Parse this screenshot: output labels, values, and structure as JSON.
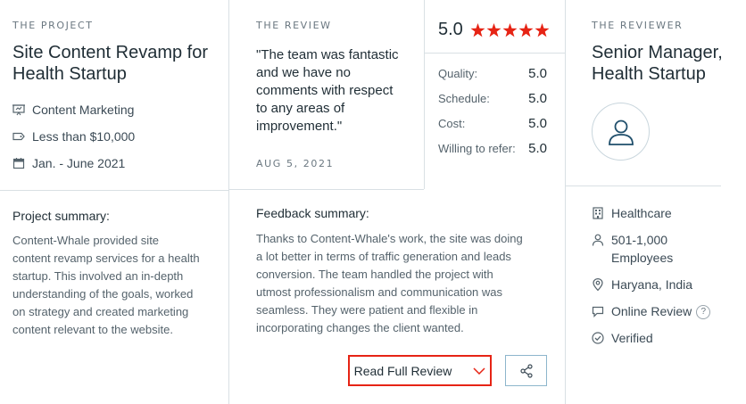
{
  "project": {
    "eyebrow": "THE PROJECT",
    "title_line1": "Site Content Revamp for",
    "title_line2": "Health Startup",
    "service": "Content Marketing",
    "budget": "Less than $10,000",
    "dates": "Jan. - June 2021",
    "summary_label": "Project summary:",
    "summary_lines": [
      "Content-Whale provided site",
      "content revamp services for a health",
      "startup. This involved an in-depth",
      "understanding of the goals, worked",
      "on strategy and created marketing",
      "content relevant to the website."
    ]
  },
  "review": {
    "eyebrow": "THE REVIEW",
    "quote_lines": [
      "\"The team was fantastic",
      "and we have no",
      "comments with respect",
      "to any areas of",
      "improvement.\""
    ],
    "date": "AUG 5, 2021",
    "overall": "5.0",
    "stars": 5,
    "scores": [
      {
        "label": "Quality:",
        "value": "5.0"
      },
      {
        "label": "Schedule:",
        "value": "5.0"
      },
      {
        "label": "Cost:",
        "value": "5.0"
      },
      {
        "label": "Willing to refer:",
        "value": "5.0"
      }
    ],
    "feedback_label": "Feedback summary:",
    "feedback_lines": [
      "Thanks to Content-Whale's work, the site was doing",
      "a lot better in terms of traffic generation and leads",
      "conversion. The team handled the project with",
      "utmost professionalism and communication was",
      "seamless. They were patient and flexible in",
      "incorporating changes the client wanted."
    ],
    "read_full_label": "Read Full Review"
  },
  "reviewer": {
    "eyebrow": "THE REVIEWER",
    "title_line1": "Senior Manager,",
    "title_line2": "Health Startup",
    "industry": "Healthcare",
    "size_line1": "501-1,000",
    "size_line2": "Employees",
    "location": "Haryana, India",
    "review_type": "Online Review",
    "verified": "Verified"
  },
  "colors": {
    "accent_red": "#e62415",
    "star": "#e62415",
    "border": "#d9e0e4",
    "icon": "#55636c",
    "share_border": "#8db6cc"
  }
}
